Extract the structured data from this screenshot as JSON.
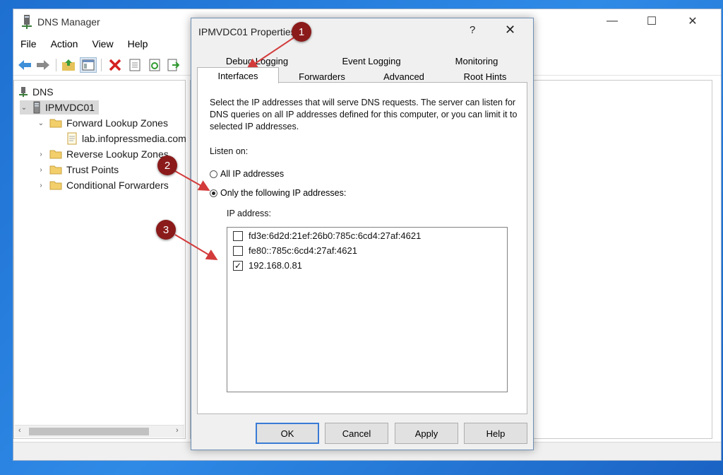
{
  "app": {
    "title": "DNS Manager",
    "minimize": "—",
    "maximize": "☐",
    "close": "✕"
  },
  "menu": [
    "File",
    "Action",
    "View",
    "Help"
  ],
  "tree": {
    "root": "DNS",
    "server": "IPMVDC01",
    "items": [
      {
        "label": "Forward Lookup Zones",
        "expander": "⌄"
      },
      {
        "label": "lab.infopressmedia.com",
        "expander": ""
      },
      {
        "label": "Reverse Lookup Zones",
        "expander": "›"
      },
      {
        "label": "Trust Points",
        "expander": "›"
      },
      {
        "label": "Conditional Forwarders",
        "expander": "›"
      }
    ],
    "server_expander": "⌄"
  },
  "scroll": {
    "left": "‹",
    "right": "›"
  },
  "dialog": {
    "title": "IPMVDC01 Properties",
    "help": "?",
    "close": "✕",
    "tabs_back": [
      "Debug Logging",
      "Event Logging",
      "Monitoring"
    ],
    "tabs_front": [
      "Interfaces",
      "Forwarders",
      "Advanced",
      "Root Hints"
    ],
    "description": "Select the IP addresses that will serve DNS requests. The server can listen for DNS queries on all IP addresses defined for this computer, or you can limit it to selected IP addresses.",
    "listen_on": "Listen on:",
    "radio_all": "All IP addresses",
    "radio_only": "Only the following IP addresses:",
    "ip_header": "IP address:",
    "ips": [
      {
        "address": "fd3e:6d2d:21ef:26b0:785c:6cd4:27af:4621",
        "checked": false
      },
      {
        "address": "fe80::785c:6cd4:27af:4621",
        "checked": false
      },
      {
        "address": "192.168.0.81",
        "checked": true
      }
    ],
    "buttons": {
      "ok": "OK",
      "cancel": "Cancel",
      "apply": "Apply",
      "help": "Help"
    }
  },
  "callouts": [
    "1",
    "2",
    "3"
  ],
  "check_mark": "✓",
  "colors": {
    "callout": "#8b1a1a",
    "arrow": "#d33b3b",
    "desktop": "#2f8ae6"
  }
}
